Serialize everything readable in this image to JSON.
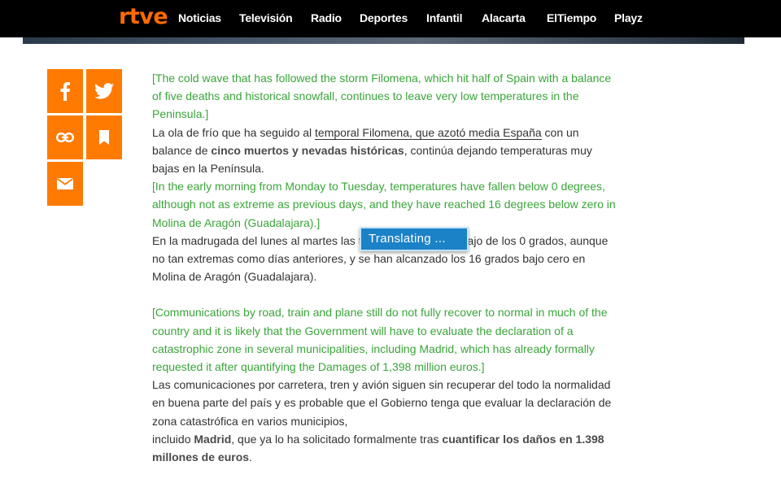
{
  "header": {
    "logo": "rtve",
    "brand_color": "#ff6a00",
    "nav": [
      "Noticias",
      "Televisión",
      "Radio",
      "Deportes",
      "Infantil",
      "Alacarta",
      "ElTiempo",
      "Playz"
    ]
  },
  "share": {
    "icons": [
      "facebook-icon",
      "twitter-icon",
      "link-icon",
      "bookmark-icon",
      "email-icon"
    ],
    "button_color": "#ff7a00"
  },
  "article": {
    "p1_en": "[The cold wave that has followed the storm Filomena, which hit half of Spain with a balance of five deaths and historical snowfall, continues to leave very low temperatures in the Peninsula.]",
    "p1_es_a": "La ola de frío que ha seguido al ",
    "p1_es_link": "temporal Filomena, que azotó media España",
    "p1_es_b": " con un balance de ",
    "p1_es_bold": "cinco muertos y nevadas históricas",
    "p1_es_c": ", continúa dejando temperaturas muy bajas en la Península.",
    "p2_en": "[In the early morning from Monday to Tuesday, temperatures have fallen below 0 degrees, although not as extreme as previous days, and they have reached 16 degrees below zero in Molina de Aragón (Guadalajara).]",
    "p2_es": "En la madrugada del lunes al martes las temperaturas por debajo de los 0 grados, aunque no tan extremas como días anteriores, y se han alcanzado los 16 grados bajo cero en Molina de Aragón (Guadalajara).",
    "p3_en": "[Communications by road, train and plane still do not fully recover to normal in much of the country and it is likely that the Government will have to evaluate the declaration of a catastrophic zone in several municipalities, including Madrid, which has already formally requested it after quantifying the Damages of 1,398 million euros.]",
    "p3_es_a": "Las comunicaciones por carretera, tren y avión siguen sin recuperar del todo la normalidad en buena parte del país y es probable que el Gobierno tenga que evaluar la declaración de zona catastrófica en varios municipios,",
    "p3_es_b": "incluido ",
    "p3_es_bold1": "Madrid",
    "p3_es_c": ", que ya lo ha solicitado formalmente tras ",
    "p3_es_bold2": "cuantificar los daños en 1.398 millones de euros",
    "p3_es_d": "."
  },
  "translate_popup": {
    "label": "Translating ..."
  }
}
